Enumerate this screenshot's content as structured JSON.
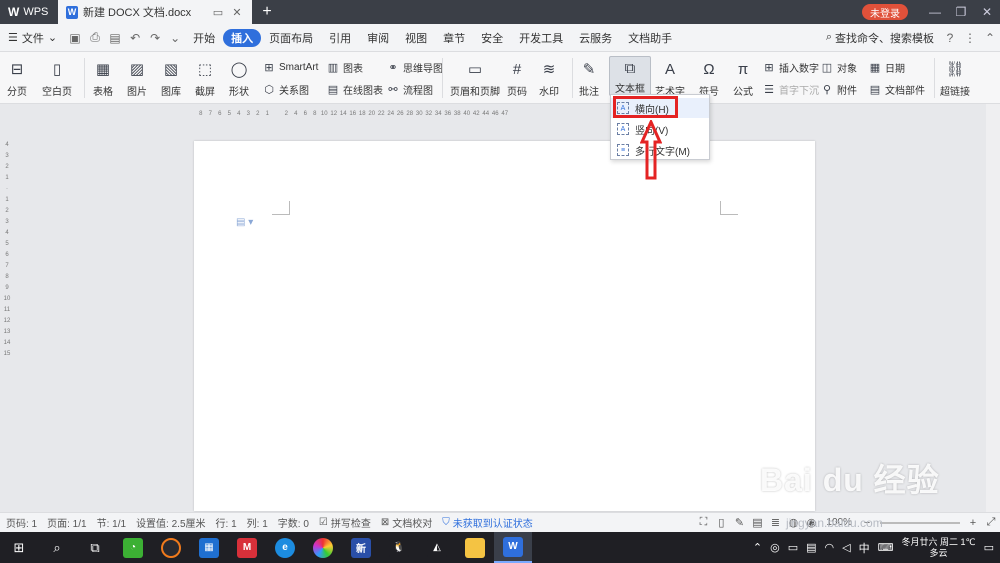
{
  "titlebar": {
    "app_name": "WPS",
    "doc_tab": "新建 DOCX 文档.docx",
    "login_badge": "未登录"
  },
  "menubar": {
    "file": "文件",
    "tabs": [
      "开始",
      "插入",
      "页面布局",
      "引用",
      "审阅",
      "视图",
      "章节",
      "安全",
      "开发工具",
      "云服务",
      "文档助手"
    ],
    "active_tab": "插入",
    "search": "查找命令、搜索模板"
  },
  "ribbon": {
    "page_break": "分页",
    "blank_page": "空白页",
    "table": "表格",
    "picture": "图片",
    "gallery": "图库",
    "screenshot": "截屏",
    "shape": "形状",
    "smartart": "SmartArt",
    "chart": "图表",
    "relation": "关系图",
    "online_chart": "在线图表",
    "mindmap": "思维导图",
    "flowchart": "流程图",
    "header_footer": "页眉和页脚",
    "page_number": "页码",
    "watermark": "水印",
    "comment": "批注",
    "textbox": "文本框",
    "wordart": "艺术字",
    "symbol": "符号",
    "formula": "公式",
    "insert_number": "插入数字",
    "object": "对象",
    "date": "日期",
    "dropcap": "首字下沉",
    "attachment": "附件",
    "doc_parts": "文档部件",
    "hyperlink": "超链接"
  },
  "dropdown": {
    "items": [
      "横向(H)",
      "竖向(V)",
      "多行文字(M)"
    ]
  },
  "ruler": {
    "ticks": [
      "8",
      "7",
      "6",
      "5",
      "4",
      "3",
      "2",
      "1",
      "",
      "2",
      "4",
      "6",
      "8",
      "10",
      "12",
      "14",
      "16",
      "18",
      "20",
      "22",
      "24",
      "26",
      "28",
      "30",
      "32",
      "34",
      "36",
      "38",
      "40",
      "42",
      "44",
      "46",
      "47"
    ]
  },
  "statusbar": {
    "page_num": "页码: 1",
    "pages": "页面: 1/1",
    "section": "节: 1/1",
    "setting": "设置值: 2.5厘米",
    "row": "行: 1",
    "col": "列: 1",
    "words": "字数: 0",
    "spell": "拼写检查",
    "proof": "文档校对",
    "auth": "未获取到认证状态",
    "zoom": "100%"
  },
  "taskbar": {
    "ime": "中",
    "clock_line1": "冬月廿六 周二 1℃",
    "clock_line2": "多云"
  },
  "watermark_text": "Bai du 经验",
  "watermark_url": "jingyan.baidu.com"
}
